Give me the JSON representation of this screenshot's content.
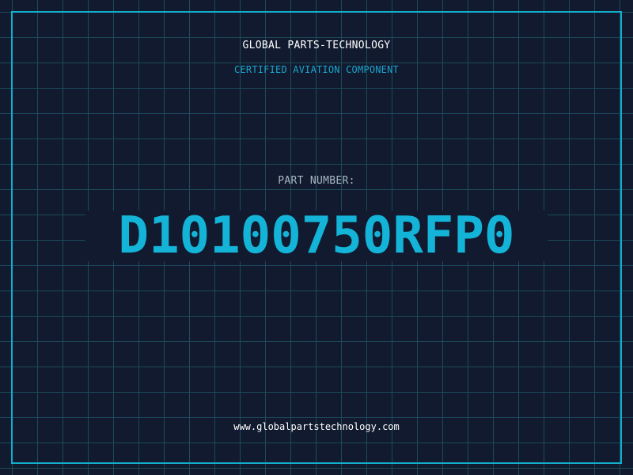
{
  "header": {
    "company": "GLOBAL PARTS-TECHNOLOGY",
    "subtitle": "CERTIFIED AVIATION COMPONENT"
  },
  "part": {
    "label": "PART NUMBER:",
    "number": "D10100750RFP0"
  },
  "footer": {
    "website": "www.globalpartstechnology.com"
  },
  "colors": {
    "background": "#111a2e",
    "grid": "#1d4a5c",
    "accent": "#14b4d8",
    "text": "#ffffff"
  }
}
